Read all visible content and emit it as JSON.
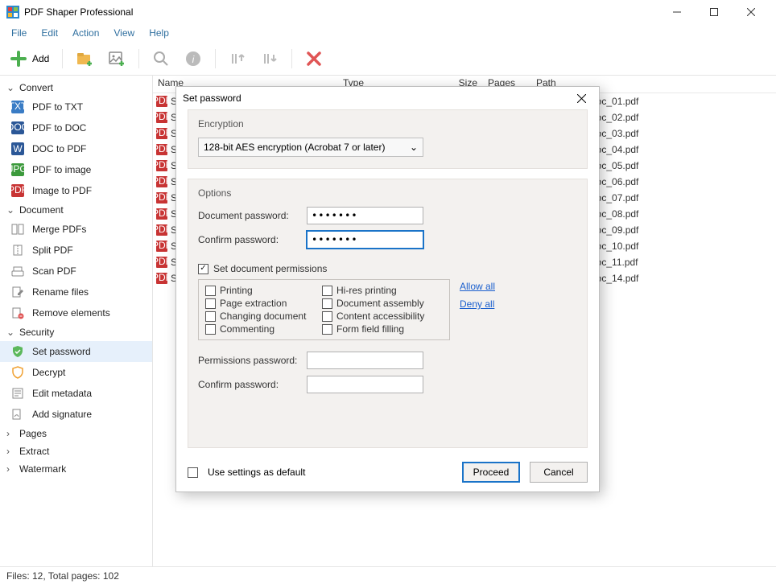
{
  "app": {
    "title": "PDF Shaper Professional"
  },
  "menu": {
    "file": "File",
    "edit": "Edit",
    "action": "Action",
    "view": "View",
    "help": "Help"
  },
  "toolbar": {
    "add": "Add"
  },
  "sidebar": {
    "convert": {
      "title": "Convert",
      "items": [
        "PDF to TXT",
        "PDF to DOC",
        "DOC to PDF",
        "PDF to image",
        "Image to PDF"
      ]
    },
    "document": {
      "title": "Document",
      "items": [
        "Merge PDFs",
        "Split PDF",
        "Scan PDF",
        "Rename files",
        "Remove elements"
      ]
    },
    "security": {
      "title": "Security",
      "items": [
        "Set password",
        "Decrypt",
        "Edit metadata",
        "Add signature"
      ]
    },
    "pages": {
      "title": "Pages"
    },
    "extract": {
      "title": "Extract"
    },
    "watermark": {
      "title": "Watermark"
    }
  },
  "filelist": {
    "headers": {
      "name": "Name",
      "type": "Type",
      "size": "Size",
      "pages": "Pages",
      "path": "Path"
    },
    "rows": [
      {
        "name": "S",
        "path": "DFs\\SampleDoc_01.pdf"
      },
      {
        "name": "S",
        "path": "DFs\\SampleDoc_02.pdf"
      },
      {
        "name": "S",
        "path": "DFs\\SampleDoc_03.pdf"
      },
      {
        "name": "S",
        "path": "DFs\\SampleDoc_04.pdf"
      },
      {
        "name": "S",
        "path": "DFs\\SampleDoc_05.pdf"
      },
      {
        "name": "S",
        "path": "DFs\\SampleDoc_06.pdf"
      },
      {
        "name": "S",
        "path": "DFs\\SampleDoc_07.pdf"
      },
      {
        "name": "S",
        "path": "DFs\\SampleDoc_08.pdf"
      },
      {
        "name": "S",
        "path": "DFs\\SampleDoc_09.pdf"
      },
      {
        "name": "S",
        "path": "DFs\\SampleDoc_10.pdf"
      },
      {
        "name": "S",
        "path": "DFs\\SampleDoc_11.pdf"
      },
      {
        "name": "S",
        "path": "DFs\\SampleDoc_14.pdf"
      }
    ]
  },
  "dialog": {
    "title": "Set password",
    "encryption": {
      "label": "Encryption",
      "value": "128-bit AES encryption (Acrobat 7 or later)"
    },
    "options": {
      "label": "Options",
      "doc_pass": "Document password:",
      "confirm_pass": "Confirm password:",
      "doc_pass_val": "●●●●●●●",
      "confirm_pass_val": "●●●●●●●",
      "set_perm": "Set document permissions",
      "perms": {
        "printing": "Printing",
        "hires": "Hi-res printing",
        "extract": "Page extraction",
        "assembly": "Document assembly",
        "change": "Changing document",
        "access": "Content accessibility",
        "comment": "Commenting",
        "form": "Form field filling"
      },
      "allow_all": "Allow all",
      "deny_all": "Deny all",
      "perm_pass": "Permissions password:",
      "perm_confirm": "Confirm password:"
    },
    "footer": {
      "use_default": "Use settings as default",
      "proceed": "Proceed",
      "cancel": "Cancel"
    }
  },
  "statusbar": {
    "text": "Files: 12, Total pages: 102"
  }
}
